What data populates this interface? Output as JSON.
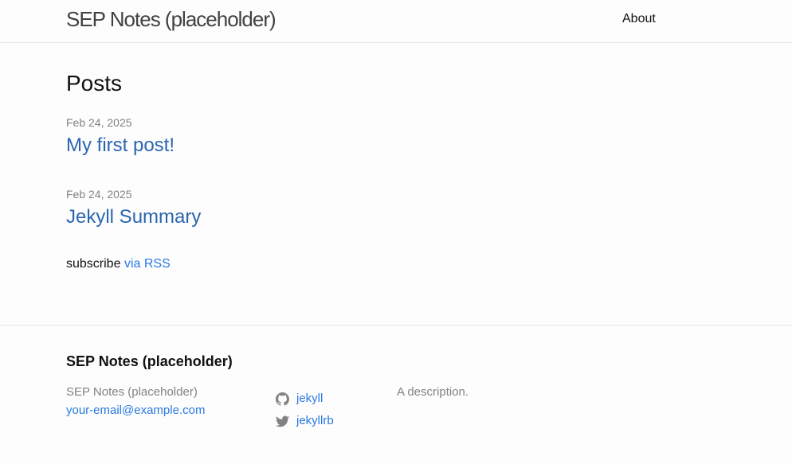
{
  "header": {
    "site_title": "SEP Notes (placeholder)",
    "nav": {
      "about_label": "About"
    }
  },
  "main": {
    "heading": "Posts",
    "posts": [
      {
        "date": "Feb 24, 2025",
        "title": "My first post!"
      },
      {
        "date": "Feb 24, 2025",
        "title": "Jekyll Summary"
      }
    ],
    "subscribe": {
      "prefix": "subscribe",
      "link_label": "via RSS"
    }
  },
  "footer": {
    "heading": "SEP Notes (placeholder)",
    "name": "SEP Notes (placeholder)",
    "email": "your-email@example.com",
    "social": [
      {
        "icon": "github-icon",
        "label": "jekyll"
      },
      {
        "icon": "twitter-icon",
        "label": "jekyllrb"
      }
    ],
    "description": "A description."
  },
  "colors": {
    "link": "#2a7ae2",
    "post_title": "#2a66b0",
    "meta": "#828282",
    "text": "#111111",
    "border": "#e8e8e8",
    "background": "#fdfdfd"
  }
}
